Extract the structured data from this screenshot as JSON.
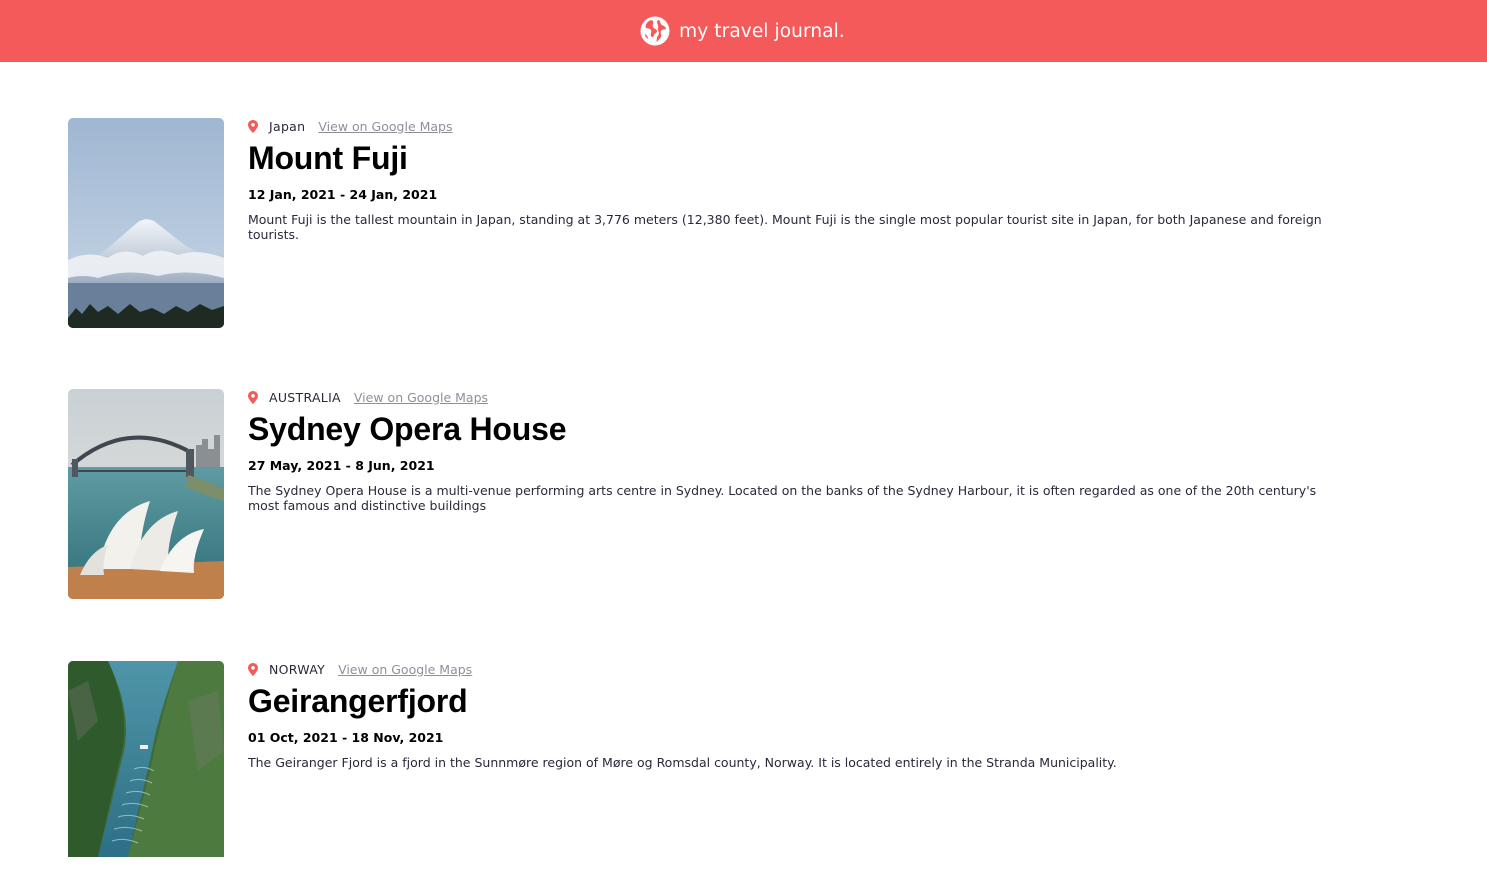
{
  "header": {
    "title": "my travel journal.",
    "icon": "globe-icon",
    "background": "#f55a5a"
  },
  "entries": [
    {
      "country": "Japan",
      "maps_link": "View on Google Maps",
      "title": "Mount Fuji",
      "dates": "12 Jan, 2021 - 24 Jan, 2021",
      "description": "Mount Fuji is the tallest mountain in Japan, standing at 3,776 meters (12,380 feet). Mount Fuji is the single most popular tourist site in Japan, for both Japanese and foreign tourists."
    },
    {
      "country": "AUSTRALIA",
      "maps_link": "View on Google Maps",
      "title": "Sydney Opera House",
      "dates": "27 May, 2021 - 8 Jun, 2021",
      "description": "The Sydney Opera House is a multi-venue performing arts centre in Sydney. Located on the banks of the Sydney Harbour, it is often regarded as one of the 20th century's most famous and distinctive buildings"
    },
    {
      "country": "NORWAY",
      "maps_link": "View on Google Maps",
      "title": "Geirangerfjord",
      "dates": "01 Oct, 2021 - 18 Nov, 2021",
      "description": "The Geiranger Fjord is a fjord in the Sunnmøre region of Møre og Romsdal county, Norway. It is located entirely in the Stranda Municipality."
    }
  ],
  "colors": {
    "accent": "#f55a5a",
    "link": "#918e9b",
    "text": "#2b283a"
  }
}
